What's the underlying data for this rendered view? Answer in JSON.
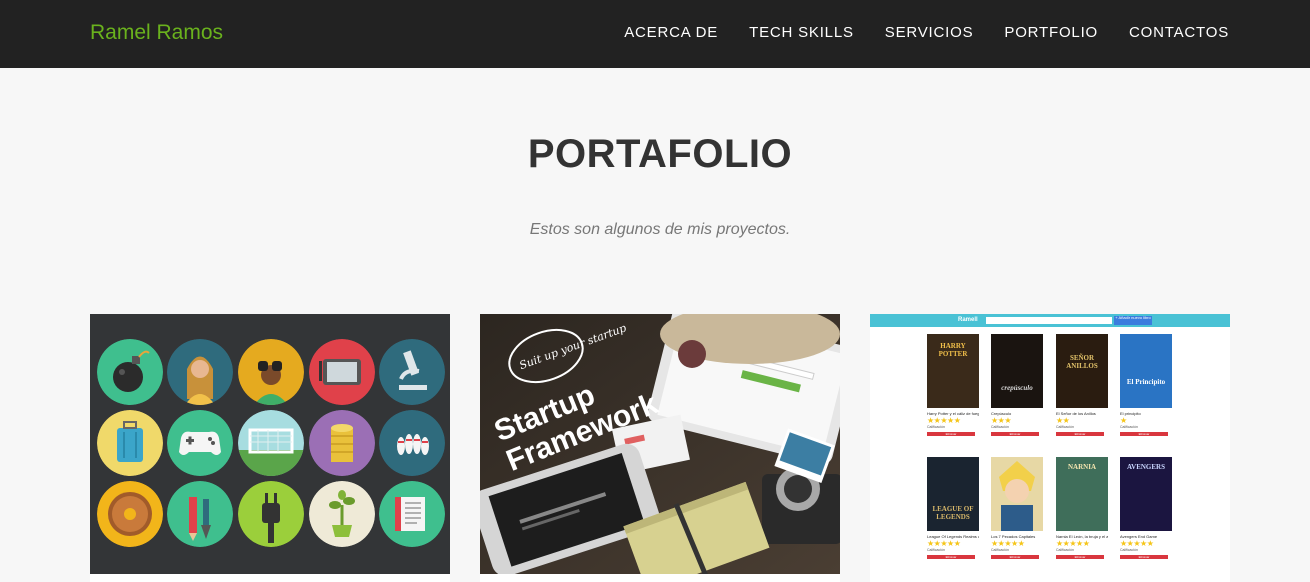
{
  "nav": {
    "brand": "Ramel Ramos",
    "items": [
      {
        "label": "ACERCA DE"
      },
      {
        "label": "TECH SKILLS"
      },
      {
        "label": "SERVICIOS"
      },
      {
        "label": "PORTFOLIO"
      },
      {
        "label": "CONTACTOS"
      }
    ]
  },
  "portfolio": {
    "title": "PORTAFOLIO",
    "subtitle": "Estos son algunos de mis proyectos.",
    "projects": [
      {
        "icon_names": [
          "bomb-icon",
          "person-icon",
          "binoculars-icon",
          "tablet-icon",
          "microscope-icon",
          "luggage-icon",
          "gamepad-icon",
          "soccer-goal-icon",
          "coins-icon",
          "bowling-icon",
          "donut-icon",
          "pencil-brush-icon",
          "plug-icon",
          "plant-icon",
          "book-icon"
        ]
      },
      {
        "script_text": "Suit up your startup",
        "title_line1": "Startup",
        "title_line2": "Framework"
      },
      {
        "app_brand": "Ramell",
        "add_button": "+ Añadir nuevo libro",
        "books": [
          {
            "title": "Harry Potter y el cáliz de fuego",
            "stars": "★★★★★",
            "cover_text": "HARRY POTTER"
          },
          {
            "title": "Crepúsculo",
            "stars": "★★★",
            "cover_text": "crepúsculo"
          },
          {
            "title": "El Señor de los Anillos",
            "stars": "★★",
            "cover_text": "SEÑOR ANILLOS"
          },
          {
            "title": "El principito",
            "stars": "★",
            "cover_text": "El Principito"
          },
          {
            "title": "League Of Legends Realms of Runeterra",
            "stars": "★★★★★",
            "cover_text": "LEAGUE OF LEGENDS"
          },
          {
            "title": "Los 7 Pecados Capitales",
            "stars": "★★★★★",
            "cover_text": ""
          },
          {
            "title": "Narnia El León, la bruja y el armario",
            "stars": "★★★★★",
            "cover_text": "NARNIA"
          },
          {
            "title": "Avengers End Game",
            "stars": "★★★★★",
            "cover_text": "AVENGERS"
          }
        ],
        "rating_label": "Calificación",
        "delete_label": "Eliminar"
      }
    ]
  },
  "colors": {
    "navbar_bg": "#222222",
    "brand": "#6ab21d",
    "page_bg": "#f7f7f7",
    "title": "#333333"
  }
}
